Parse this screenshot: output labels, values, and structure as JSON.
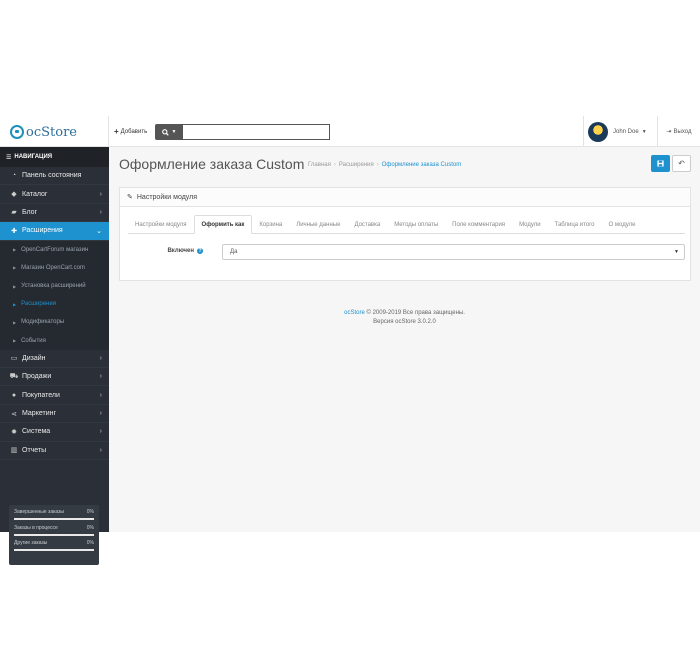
{
  "header": {
    "logo_oc": "oc",
    "logo_store": "Store",
    "add_label": "Добавить",
    "search_placeholder": "",
    "user_name": "John Doe",
    "logout_label": "Выход"
  },
  "sidebar": {
    "nav_title": "НАВИГАЦИЯ",
    "items": [
      {
        "label": "Панель состояния",
        "icon": "dashboard-icon"
      },
      {
        "label": "Каталог",
        "icon": "tag-icon"
      },
      {
        "label": "Блог",
        "icon": "book-icon"
      },
      {
        "label": "Расширения",
        "icon": "puzzle-icon"
      },
      {
        "label": "Дизайн",
        "icon": "monitor-icon"
      },
      {
        "label": "Продажи",
        "icon": "cart-icon"
      },
      {
        "label": "Покупатели",
        "icon": "user-icon"
      },
      {
        "label": "Маркетинг",
        "icon": "share-icon"
      },
      {
        "label": "Система",
        "icon": "gear-icon"
      },
      {
        "label": "Отчеты",
        "icon": "bar-chart-icon"
      }
    ],
    "subitems": [
      {
        "label": "OpenCartForum магазин"
      },
      {
        "label": "Магазин OpenCart.com"
      },
      {
        "label": "Установка расширений"
      },
      {
        "label": "Расширения"
      },
      {
        "label": "Модификаторы"
      },
      {
        "label": "События"
      }
    ],
    "stats": [
      {
        "label": "Завершенные заказы",
        "value": "0%"
      },
      {
        "label": "Заказы в процессе",
        "value": "0%"
      },
      {
        "label": "Другие заказы",
        "value": "0%"
      }
    ]
  },
  "main": {
    "title": "Оформление заказа Custom",
    "breadcrumb": [
      "Главная",
      "Расширения",
      "Оформление заказа Custom"
    ],
    "panel_title": "Настройки модуля",
    "tabs": [
      "Настройки модуля",
      "Оформить как",
      "Корзина",
      "Личные данные",
      "Доставка",
      "Методы оплаты",
      "Поле комментария",
      "Модули",
      "Таблица итого",
      "О модуле"
    ],
    "field_label": "Включен",
    "field_value": "Да"
  },
  "footer": {
    "brand": "ocStore",
    "copyright": "© 2009-2019 Все права защищены.",
    "version": "Версия ocStore 3.0.2.0"
  },
  "colors": {
    "accent": "#1e91cf",
    "sidebar_bg": "#2b3038",
    "content_bg": "#f6f6f6"
  }
}
